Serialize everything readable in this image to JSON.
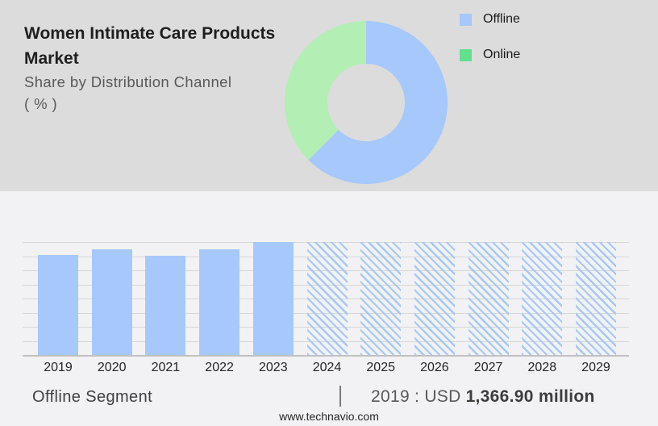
{
  "page": {
    "title_line1": "Women Intimate Care Products",
    "title_line2": "Market",
    "subtitle_line1": "Share by Distribution Channel",
    "subtitle_line2": "( % )"
  },
  "legend": {
    "items": [
      {
        "label": "Offline",
        "color": "#a6c8fa"
      },
      {
        "label": "Online",
        "color": "#62e08d"
      }
    ]
  },
  "chart_data": [
    {
      "type": "pie",
      "subtype": "donut",
      "title": "Women Intimate Care Products Market - Share by Distribution Channel ( % )",
      "labels": [
        "Offline",
        "Online"
      ],
      "values_pct": [
        62.5,
        37.5
      ],
      "colors": [
        "#a6c8fa",
        "#b3eeb5"
      ],
      "legend_position": "top-right",
      "start_angle_deg": 0
    },
    {
      "type": "bar",
      "title": "Offline Segment",
      "categories": [
        "2019",
        "2020",
        "2021",
        "2022",
        "2023",
        "2024",
        "2025",
        "2026",
        "2027",
        "2028",
        "2029"
      ],
      "bars": [
        {
          "year": "2019",
          "rel_height": 0.886,
          "hatched": false
        },
        {
          "year": "2020",
          "rel_height": 0.936,
          "hatched": false
        },
        {
          "year": "2021",
          "rel_height": 0.879,
          "hatched": false
        },
        {
          "year": "2022",
          "rel_height": 0.936,
          "hatched": false
        },
        {
          "year": "2023",
          "rel_height": 1.0,
          "hatched": false
        },
        {
          "year": "2024",
          "rel_height": 1.0,
          "hatched": true
        },
        {
          "year": "2025",
          "rel_height": 1.0,
          "hatched": true
        },
        {
          "year": "2026",
          "rel_height": 1.0,
          "hatched": true
        },
        {
          "year": "2027",
          "rel_height": 1.0,
          "hatched": true
        },
        {
          "year": "2028",
          "rel_height": 1.0,
          "hatched": true
        },
        {
          "year": "2029",
          "rel_height": 1.0,
          "hatched": true
        }
      ],
      "bar_color": "#a6c8fa",
      "hatch_note": "2024-2029 shown as diagonal-hatched forecast bars",
      "known_values": {
        "2019": "USD 1,366.90 million"
      },
      "grid": "horizontal",
      "gridline_count": 9,
      "ylabel": "",
      "xlabel": ""
    }
  ],
  "footnote": {
    "segment_label": "Offline Segment",
    "separator": "|",
    "stat_year_prefix": "2019 : USD",
    "stat_value_bold": "1,366.90 million"
  },
  "footer": {
    "website": "www.technavio.com"
  }
}
